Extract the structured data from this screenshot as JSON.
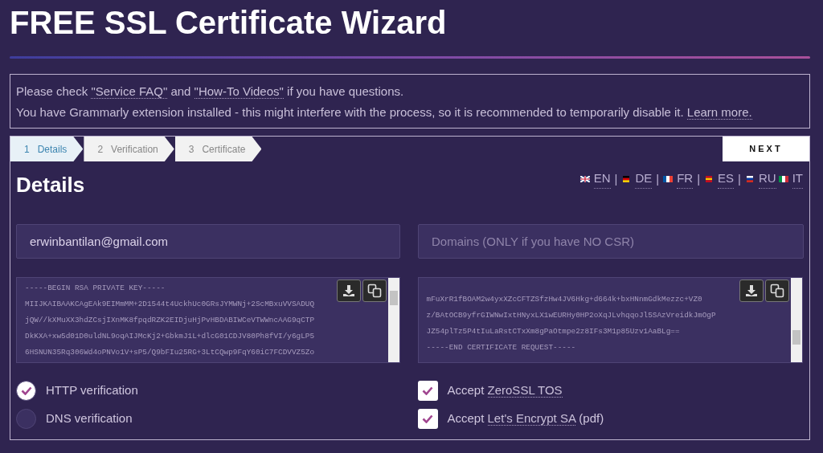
{
  "page_title": "FREE SSL Certificate Wizard",
  "notice": {
    "lines": [
      {
        "parts": [
          {
            "text": "Please check "
          },
          {
            "text": "\"Service FAQ\"",
            "link": true
          },
          {
            "text": " and "
          },
          {
            "text": "\"How-To Videos\"",
            "link": true
          },
          {
            "text": " if you have questions."
          }
        ]
      },
      {
        "parts": [
          {
            "text": "You have Grammarly extension installed - this might interfere with the process, so it is recommended to temporarily disable it. "
          },
          {
            "text": "Learn more.",
            "link": true
          }
        ]
      }
    ]
  },
  "steps": [
    {
      "number": "1",
      "label": "Details",
      "selected": true
    },
    {
      "number": "2",
      "label": "Verification",
      "selected": false
    },
    {
      "number": "3",
      "label": "Certificate",
      "selected": false
    }
  ],
  "next_button": "NEXT",
  "section_title": "Details",
  "languages": [
    {
      "code": "EN",
      "kind": "uk",
      "separator": "|"
    },
    {
      "code": "DE",
      "kind": "de",
      "separator": "|"
    },
    {
      "code": "FR",
      "kind": "fr",
      "separator": "|"
    },
    {
      "code": "ES",
      "kind": "es",
      "separator": "|"
    },
    {
      "code": "RU",
      "kind": "ru"
    },
    {
      "code": "IT",
      "kind": "it"
    }
  ],
  "email_field": {
    "value": "erwinbantilan@gmail.com"
  },
  "domains_field": {
    "placeholder": "Domains (ONLY if you have NO CSR)"
  },
  "key_boxes": [
    {
      "lines": [
        "-----BEGIN RSA PRIVATE KEY-----",
        "MIIJKAIBAAKCAgEAk9EIMmMM+2D1544t4UckhUc0GRsJYMWNj+2ScMBxuVVSADUQ",
        "jQW//kXMuXX3hdZCsjIXnMK8fpqdRZK2EIDjuHjPvHBDABIWCeVTWWncAAG9qCTP",
        "DkKXA+xw5d01D0uldNL9oqAIJMcKj2+GbkmJ1L+dlcG01CDJV80Ph8fVI/y6gLP5",
        "6HSNUN35Rq306Wd4oPNVo1V+sP5/Q9bFIu25RG+3LtCQwp9FqY60iC7FCDVVZ5Zo"
      ]
    },
    {
      "lines": [
        "mFuXrR1fBOAM2w4yxXZcCFTZSfzHw4JV6Hkg+d664k+bxHNnmGdkMezzc+VZ0",
        "z/BAtOCB9yfrGIWNwIxtHNyxLX1wEURHy0HP2oXqJLvhqqoJl5SAzVreidkJmOgP",
        "JZ54plTz5P4tIuLaRstCTxXm8gPaOtmpe2z8IFs3M1p85Uzv1AaBLg==",
        "-----END CERTIFICATE REQUEST-----"
      ]
    }
  ],
  "verification_options": [
    {
      "label": "HTTP verification",
      "selected": true
    },
    {
      "label": "DNS verification",
      "selected": false
    }
  ],
  "agreements": [
    {
      "checked": true,
      "parts": [
        {
          "text": "Accept "
        },
        {
          "text": "ZeroSSL TOS",
          "link": true
        }
      ]
    },
    {
      "checked": true,
      "parts": [
        {
          "text": "Accept "
        },
        {
          "text": "Let's Encrypt SA",
          "link": true
        },
        {
          "text": " (pdf)"
        }
      ]
    }
  ]
}
